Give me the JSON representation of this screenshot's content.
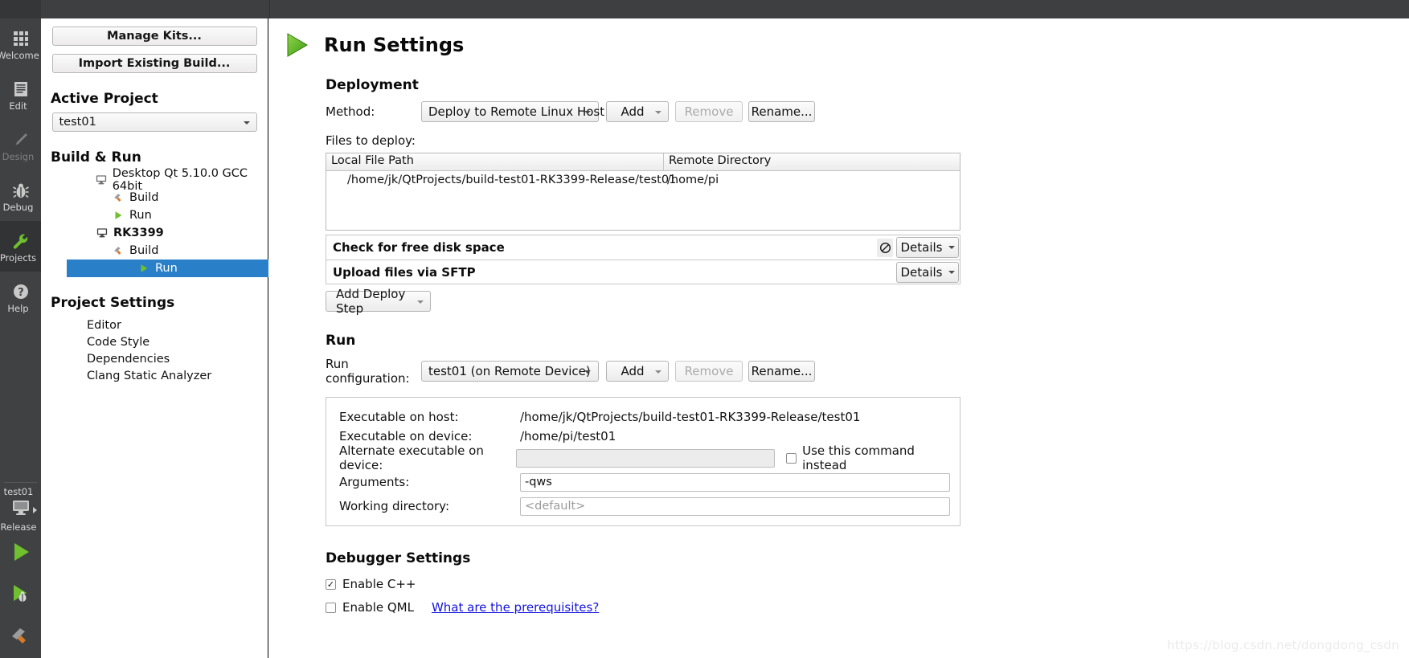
{
  "modebar": {
    "items": [
      {
        "label": "Welcome",
        "icon": "grid-icon",
        "state": "normal"
      },
      {
        "label": "Edit",
        "icon": "document-icon",
        "state": "normal"
      },
      {
        "label": "Design",
        "icon": "pencil-icon",
        "state": "disabled"
      },
      {
        "label": "Debug",
        "icon": "bug-icon",
        "state": "normal"
      },
      {
        "label": "Projects",
        "icon": "wrench-icon",
        "state": "active"
      },
      {
        "label": "Help",
        "icon": "question-icon",
        "state": "normal"
      }
    ],
    "kit_selector": {
      "project": "test01",
      "device_icon": "desktop-icon",
      "build_config": "Release",
      "run_button": "run-icon",
      "debug_button": "debug-icon",
      "build_button": "build-hammer-icon"
    }
  },
  "project_panel": {
    "manage_kits_label": "Manage Kits...",
    "import_build_label": "Import Existing Build...",
    "active_project_heading": "Active Project",
    "active_project_value": "test01",
    "build_run_heading": "Build & Run",
    "tree": [
      {
        "label": "Desktop Qt 5.10.0 GCC 64bit",
        "icon": "desktop-icon",
        "level": 1,
        "bold": false,
        "selected": false
      },
      {
        "label": "Build",
        "icon": "hammer-icon",
        "level": 2,
        "bold": false,
        "selected": false
      },
      {
        "label": "Run",
        "icon": "run-icon",
        "level": 2,
        "bold": false,
        "selected": false
      },
      {
        "label": "RK3399",
        "icon": "desktop-icon",
        "level": 1,
        "bold": true,
        "selected": false
      },
      {
        "label": "Build",
        "icon": "hammer-icon",
        "level": 2,
        "bold": false,
        "selected": false
      },
      {
        "label": "Run",
        "icon": "run-icon",
        "level": 2,
        "bold": false,
        "selected": true
      }
    ],
    "project_settings_heading": "Project Settings",
    "settings": [
      "Editor",
      "Code Style",
      "Dependencies",
      "Clang Static Analyzer"
    ]
  },
  "main": {
    "page_title": "Run Settings",
    "page_icon": "run-icon",
    "deployment": {
      "heading": "Deployment",
      "method_label": "Method:",
      "method_value": "Deploy to Remote Linux Host",
      "add_label": "Add",
      "remove_label": "Remove",
      "rename_label": "Rename...",
      "files_label": "Files to deploy:",
      "table": {
        "columns": [
          "Local File Path",
          "Remote Directory"
        ],
        "rows": [
          [
            "/home/jk/QtProjects/build-test01-RK3399-Release/test01",
            "/home/pi"
          ]
        ]
      },
      "steps": [
        {
          "name": "Check for free disk space",
          "has_disable": true,
          "disable_icon": "no-entry-icon",
          "details_label": "Details"
        },
        {
          "name": "Upload files via SFTP",
          "has_disable": false,
          "details_label": "Details"
        }
      ],
      "add_deploy_step_label": "Add Deploy Step"
    },
    "run": {
      "heading": "Run",
      "config_label": "Run configuration:",
      "config_value": "test01 (on Remote Device)",
      "add_label": "Add",
      "remove_label": "Remove",
      "rename_label": "Rename...",
      "details": {
        "exec_host_label": "Executable on host:",
        "exec_host_value": "/home/jk/QtProjects/build-test01-RK3399-Release/test01",
        "exec_device_label": "Executable on device:",
        "exec_device_value": "/home/pi/test01",
        "alt_exec_label": "Alternate executable on device:",
        "alt_exec_value": "",
        "use_command_label": "Use this command instead",
        "use_command_checked": false,
        "arguments_label": "Arguments:",
        "arguments_value": "-qws",
        "workdir_label": "Working directory:",
        "workdir_value": "",
        "workdir_placeholder": "<default>"
      }
    },
    "debugger": {
      "heading": "Debugger Settings",
      "enable_cpp_label": "Enable C++",
      "enable_cpp_checked": true,
      "enable_cpp_mark": "✓",
      "enable_qml_label": "Enable QML",
      "enable_qml_checked": false,
      "prerequisites_link": "What are the prerequisites?"
    }
  },
  "watermark": "https://blog.csdn.net/dongdong_csdn",
  "colors": {
    "selection_blue": "#2a80c8",
    "mode_bar_bg": "#3f4143",
    "link_blue": "#1414e0",
    "run_green": "#4caf26"
  }
}
